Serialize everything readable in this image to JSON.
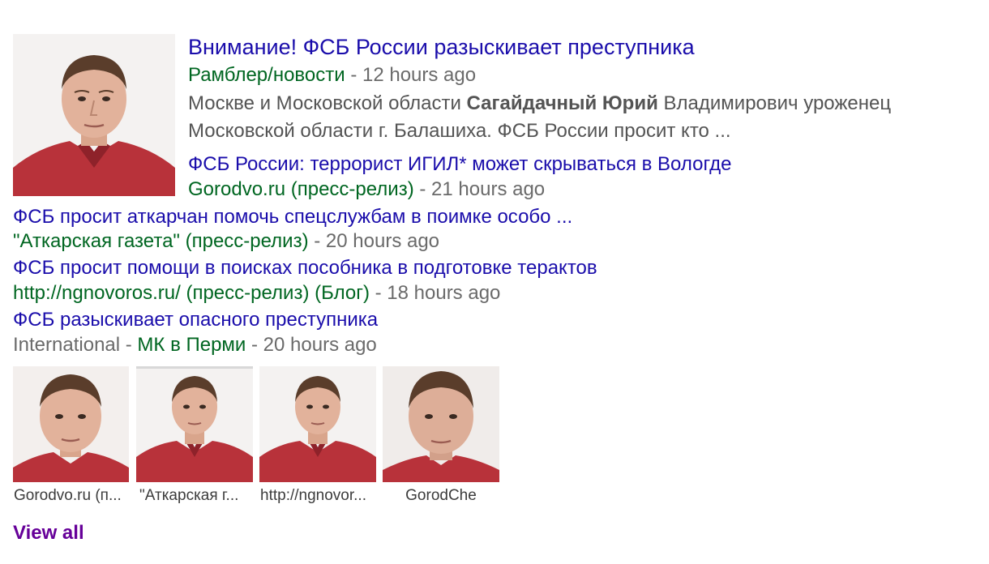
{
  "top_story": {
    "title": "Внимание! ФСБ России разыскивает преступника",
    "source": "Рамблер/новости",
    "separator": " - ",
    "time": "12 hours ago",
    "snippet_before": "Москве и Московской области ",
    "snippet_bold": "Сагайдачный Юрий",
    "snippet_after": " Владимирович уроженец Московской области г. Балашиха. ФСБ России просит кто ..."
  },
  "stories": [
    {
      "title": "ФСБ России: террорист ИГИЛ* может скрываться в Вологде",
      "source": "Gorodvo.ru (пресс-релиз)",
      "separator": " - ",
      "time": "21 hours ago"
    },
    {
      "title": "ФСБ просит аткарчан помочь спецслужбам в поимке особо ...",
      "source": "\"Аткарская газета\" (пресс-релиз)",
      "separator": " - ",
      "time": "20 hours ago"
    },
    {
      "title": "ФСБ просит помощи в поисках пособника в подготовке терактов",
      "source": "http://ngnovoros.ru/ (пресс-релиз) (Блог)",
      "separator": " - ",
      "time": "18 hours ago"
    },
    {
      "title": "ФСБ разыскивает опасного преступника",
      "source_prefix": "International",
      "source": "МК в Перми",
      "separator": " - ",
      "time": "20 hours ago"
    }
  ],
  "thumbnails": [
    {
      "caption": "Gorodvo.ru (п..."
    },
    {
      "caption": "\"Аткарская г..."
    },
    {
      "caption": "http://ngnovor..."
    },
    {
      "caption": "GorodChe"
    }
  ],
  "view_all": "View all",
  "colors": {
    "link": "#1a0dab",
    "source": "#006621",
    "meta": "#6a6a6a",
    "view_all": "#660099"
  }
}
